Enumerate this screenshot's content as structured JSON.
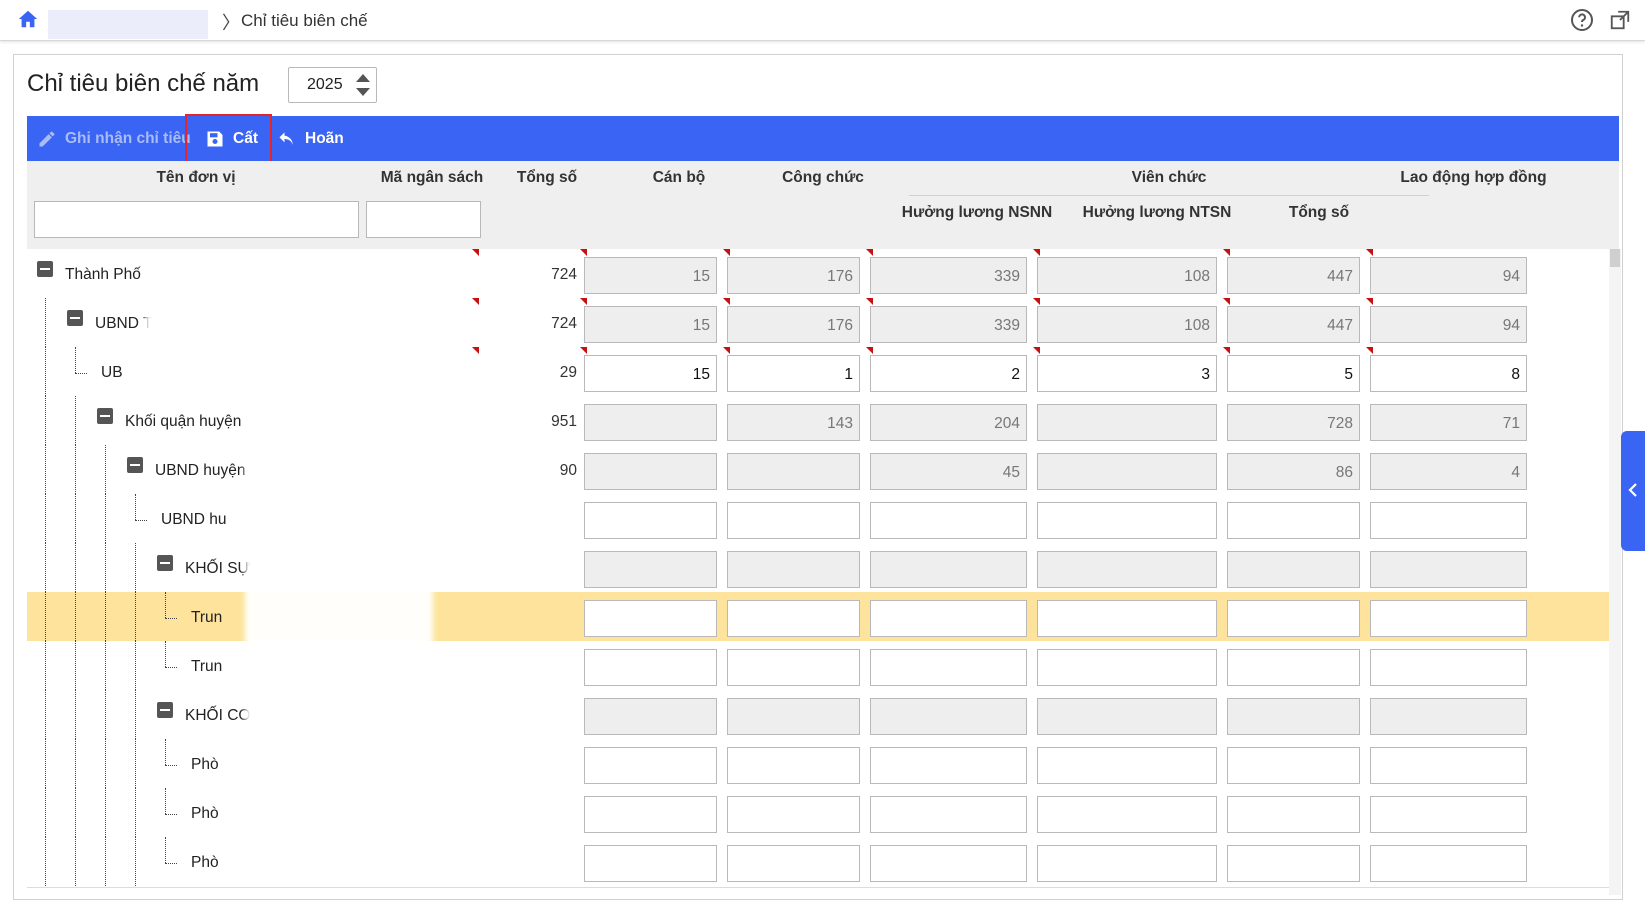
{
  "breadcrumb": {
    "separator": "〉",
    "current": "Chỉ tiêu biên chế"
  },
  "icons": {
    "home": "home-icon",
    "help": "help-icon",
    "popout": "popout-icon",
    "save": "save-icon",
    "edit": "pencil-icon",
    "undo": "undo-icon",
    "collapse": "chevron-left-icon"
  },
  "page": {
    "title": "Chỉ tiêu biên chế năm",
    "year": "2025"
  },
  "toolbar": {
    "record_label": "Ghi nhận chỉ tiêu",
    "save_label": "Cất",
    "undo_label": "Hoãn"
  },
  "columns": {
    "unit": "Tên đơn vị",
    "budget_code": "Mã ngân sách",
    "total": "Tổng số",
    "can_bo": "Cán bộ",
    "cong_chuc": "Công chức",
    "vien_chuc": "Viên chức",
    "vc_nsnn": "Hưởng lương NSNN",
    "vc_ntsn": "Hưởng lương NTSN",
    "vc_total": "Tổng số",
    "lao_dong": "Lao động hợp đồng"
  },
  "rows": [
    {
      "name": "Thành Phố",
      "total": "724",
      "can_bo": "15",
      "cong_chuc": "176",
      "vc_nsnn": "339",
      "vc_ntsn": "108",
      "vc_total": "447",
      "lao_dong": "94"
    },
    {
      "name": "UBND T",
      "total": "724",
      "can_bo": "15",
      "cong_chuc": "176",
      "vc_nsnn": "339",
      "vc_ntsn": "108",
      "vc_total": "447",
      "lao_dong": "94"
    },
    {
      "name": "UB",
      "total": "29",
      "can_bo": "15",
      "cong_chuc": "1",
      "vc_nsnn": "2",
      "vc_ntsn": "3",
      "vc_total": "5",
      "lao_dong": "8"
    },
    {
      "name": "Khối quận huyện",
      "total": "951",
      "can_bo": "",
      "cong_chuc": "143",
      "vc_nsnn": "204",
      "vc_ntsn": "",
      "vc_total": "728",
      "lao_dong": "71"
    },
    {
      "name": "UBND huyện",
      "total": "90",
      "can_bo": "",
      "cong_chuc": "",
      "vc_nsnn": "45",
      "vc_ntsn": "",
      "vc_total": "86",
      "lao_dong": "4"
    },
    {
      "name": "UBND hu",
      "total": "",
      "can_bo": "",
      "cong_chuc": "",
      "vc_nsnn": "",
      "vc_ntsn": "",
      "vc_total": "",
      "lao_dong": ""
    },
    {
      "name": "KHỐI SỰ",
      "total": "",
      "can_bo": "",
      "cong_chuc": "",
      "vc_nsnn": "",
      "vc_ntsn": "",
      "vc_total": "",
      "lao_dong": ""
    },
    {
      "name": "Trun",
      "total": "",
      "can_bo": "",
      "cong_chuc": "",
      "vc_nsnn": "",
      "vc_ntsn": "",
      "vc_total": "",
      "lao_dong": ""
    },
    {
      "name": "Trun",
      "total": "",
      "can_bo": "",
      "cong_chuc": "",
      "vc_nsnn": "",
      "vc_ntsn": "",
      "vc_total": "",
      "lao_dong": ""
    },
    {
      "name": "KHỐI CO",
      "total": "",
      "can_bo": "",
      "cong_chuc": "",
      "vc_nsnn": "",
      "vc_ntsn": "",
      "vc_total": "",
      "lao_dong": ""
    },
    {
      "name": "Phò",
      "total": "",
      "can_bo": "",
      "cong_chuc": "",
      "vc_nsnn": "",
      "vc_ntsn": "",
      "vc_total": "",
      "lao_dong": ""
    },
    {
      "name": "Phò",
      "total": "",
      "can_bo": "",
      "cong_chuc": "",
      "vc_nsnn": "",
      "vc_ntsn": "",
      "vc_total": "",
      "lao_dong": ""
    },
    {
      "name": "Phò",
      "total": "",
      "can_bo": "",
      "cong_chuc": "",
      "vc_nsnn": "",
      "vc_ntsn": "",
      "vc_total": "",
      "lao_dong": ""
    }
  ]
}
